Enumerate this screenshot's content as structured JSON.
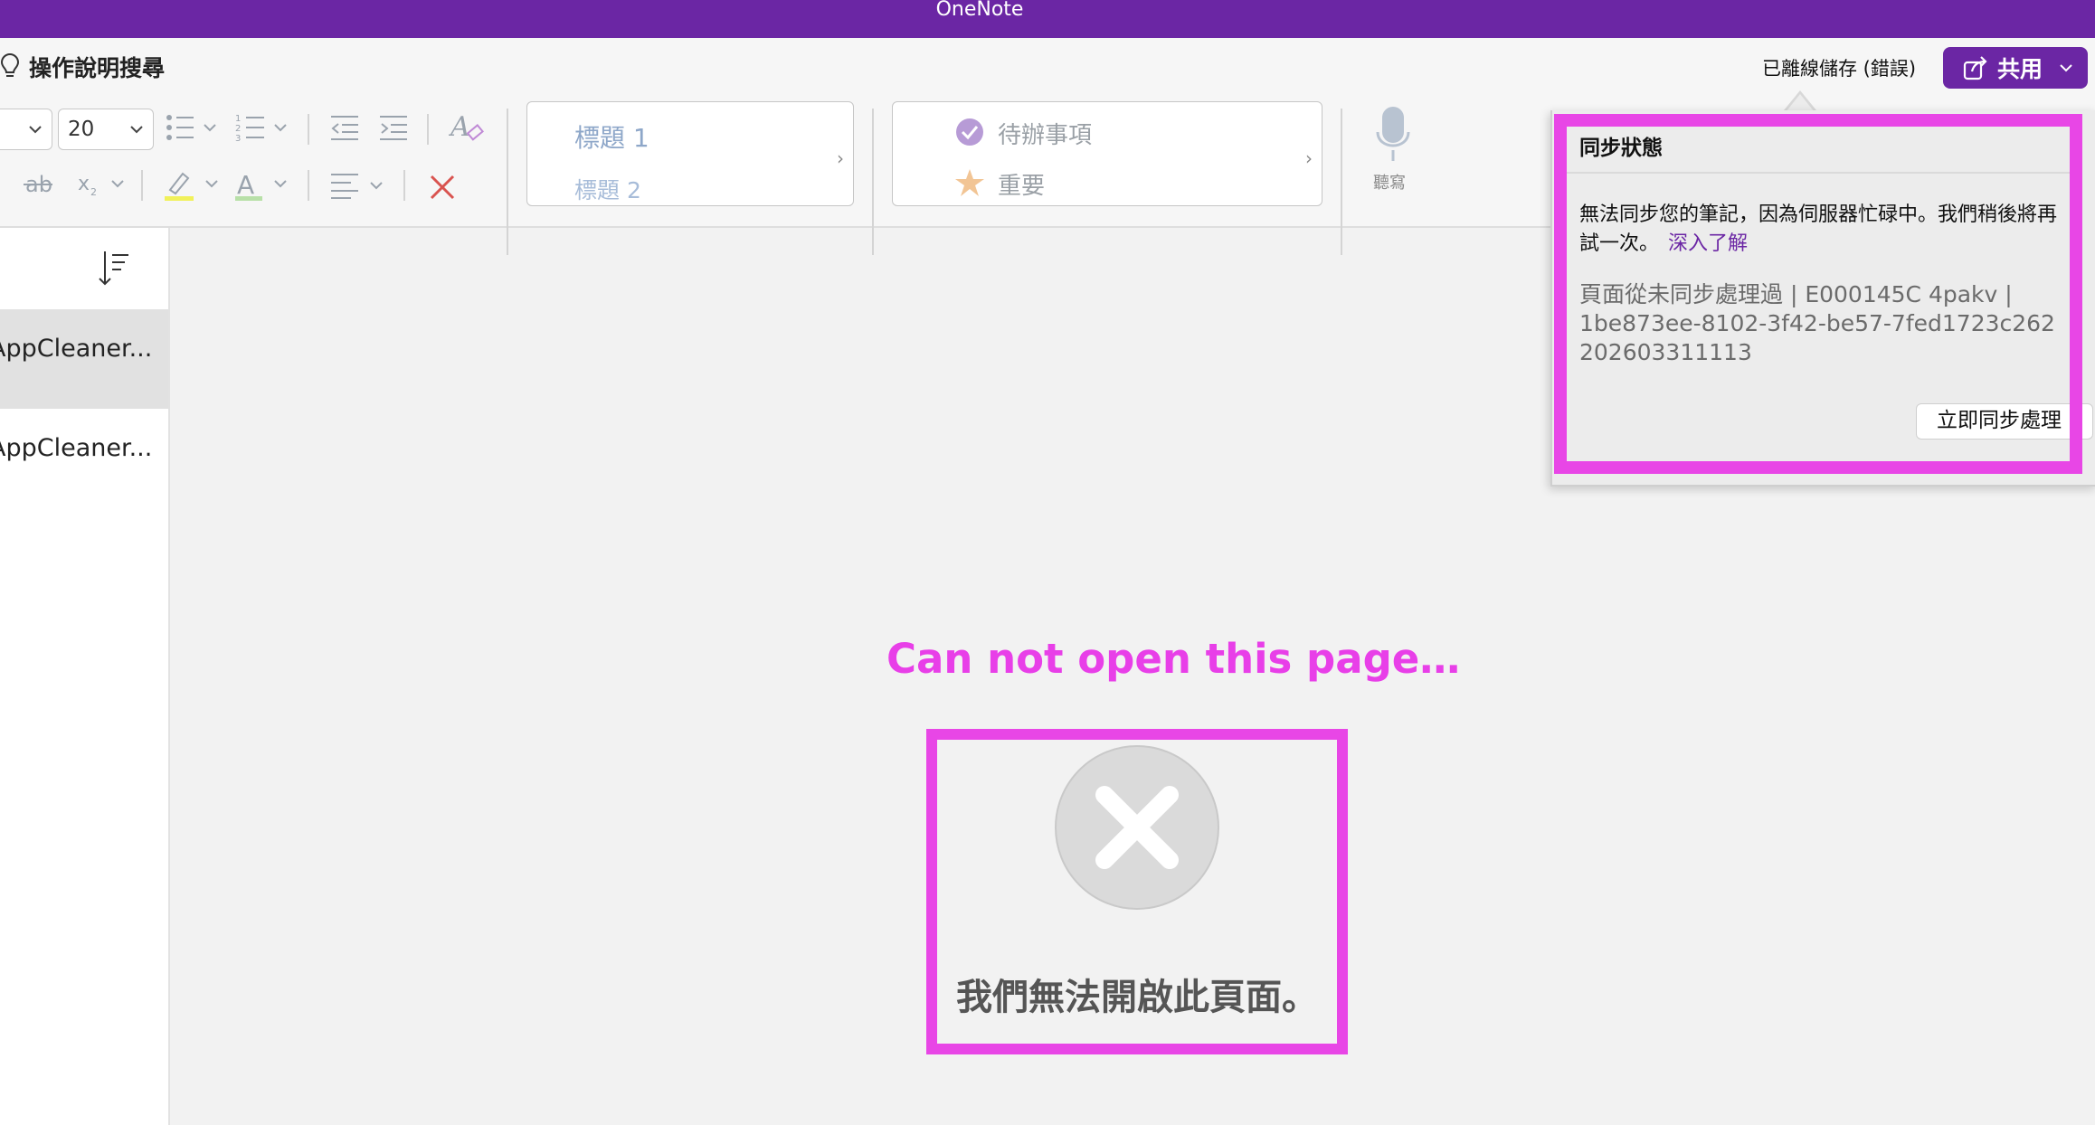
{
  "app": {
    "title": "OneNote"
  },
  "header": {
    "help_search_label": "操作說明搜尋",
    "save_status": "已離線儲存 (錯誤)",
    "share_label": "共用"
  },
  "ribbon": {
    "font_size": "20",
    "styles": {
      "heading1": "標題 1",
      "heading2": "標題 2"
    },
    "tags": {
      "todo": "待辦事項",
      "important": "重要"
    },
    "dictate_label": "聽寫"
  },
  "sidebar": {
    "pages": [
      {
        "title": "AppCleaner...",
        "selected": true
      },
      {
        "title": "AppCleaner...",
        "selected": false
      }
    ]
  },
  "main": {
    "annotation": "Can not open this page…",
    "error_message": "我們無法開啟此頁面。"
  },
  "sync_popup": {
    "title": "同步狀態",
    "message_line1": "無法同步您的筆記，因為伺服器忙碌中。我們稍後將再",
    "message_line2": "試一次。",
    "learn_more": "深入了解",
    "detail_line1": "頁面從未同步處理過 | E000145C 4pakv |",
    "detail_line2": "1be873ee-8102-3f42-be57-7fed1723c262",
    "detail_line3": "202603311113",
    "sync_now_button": "立即同步處理"
  },
  "colors": {
    "brand": "#6b26a4",
    "highlight": "#e846e6"
  }
}
